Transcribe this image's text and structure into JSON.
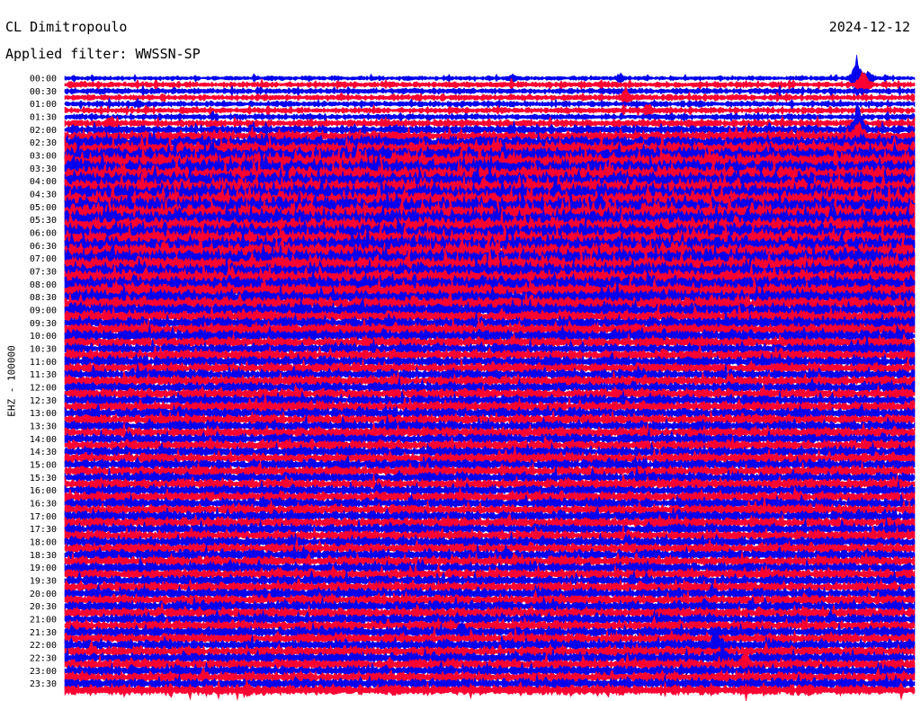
{
  "header": {
    "station": "CL Dimitropoulo",
    "date": "2024-12-12",
    "filter": "Applied filter: WWSSN-SP"
  },
  "chart_data": {
    "type": "line",
    "title": "CL Dimitropoulo",
    "subtitle": "Applied filter: WWSSN-SP",
    "date": "2024-12-12",
    "ylabel": "EHZ - 100000",
    "xlabel": "",
    "row_interval_minutes": 15,
    "row_labels": [
      "00:00",
      "00:30",
      "01:00",
      "01:30",
      "02:00",
      "02:30",
      "03:00",
      "03:30",
      "04:00",
      "04:30",
      "05:00",
      "05:30",
      "06:00",
      "06:30",
      "07:00",
      "07:30",
      "08:00",
      "08:30",
      "09:00",
      "09:30",
      "10:00",
      "10:30",
      "11:00",
      "11:30",
      "12:00",
      "12:30",
      "13:00",
      "13:30",
      "14:00",
      "14:30",
      "15:00",
      "15:30",
      "16:00",
      "16:30",
      "17:00",
      "17:30",
      "18:00",
      "18:30",
      "19:00",
      "19:30",
      "20:00",
      "20:30",
      "21:00",
      "21:30",
      "22:00",
      "22:30",
      "23:00",
      "23:30"
    ],
    "trace_colors": [
      "#0000ee",
      "#ff0033"
    ],
    "row_noise_level": [
      3,
      4,
      4,
      4,
      4,
      4,
      4,
      5,
      6,
      7,
      9,
      10,
      11,
      12,
      12,
      12,
      12,
      12,
      13,
      13,
      13,
      13,
      13,
      12,
      12,
      12,
      12,
      12,
      12,
      12,
      11,
      11,
      11,
      10,
      9,
      9,
      9,
      8,
      8,
      8,
      8,
      7,
      7,
      7,
      7,
      7,
      7,
      7,
      7,
      7,
      7,
      7,
      7,
      7,
      7,
      7,
      7,
      7,
      7,
      7,
      7,
      7,
      7,
      7,
      7,
      7,
      7,
      7,
      7,
      7,
      7,
      7,
      7,
      7,
      7,
      7,
      7,
      7,
      7,
      7,
      7,
      7,
      7,
      7,
      7,
      7,
      7,
      7,
      7,
      7,
      7,
      7,
      7,
      7,
      7,
      7
    ],
    "events": [
      {
        "row": 0,
        "minute": 14.2,
        "amplitude": 15
      },
      {
        "row": 0,
        "minute": 9.8,
        "amplitude": 10
      },
      {
        "row": 0,
        "minute": 7.9,
        "amplitude": 8
      },
      {
        "row": 0,
        "minute": 14.0,
        "amplitude": 40
      },
      {
        "row": 1,
        "minute": 14.1,
        "amplitude": 30
      },
      {
        "row": 3,
        "minute": 9.9,
        "amplitude": 18
      },
      {
        "row": 5,
        "minute": 10.3,
        "amplitude": 14
      },
      {
        "row": 7,
        "minute": 0.8,
        "amplitude": 14
      },
      {
        "row": 8,
        "minute": 14.0,
        "amplitude": 50
      },
      {
        "row": 9,
        "minute": 14.0,
        "amplitude": 40
      },
      {
        "row": 12,
        "minute": 2.6,
        "amplitude": 25
      },
      {
        "row": 13,
        "minute": 3.4,
        "amplitude": 22
      },
      {
        "row": 22,
        "minute": 2.0,
        "amplitude": 22
      },
      {
        "row": 74,
        "minute": 1.0,
        "amplitude": 10
      },
      {
        "row": 82,
        "minute": 11.3,
        "amplitude": 18
      },
      {
        "row": 86,
        "minute": 7.0,
        "amplitude": 20
      },
      {
        "row": 88,
        "minute": 11.5,
        "amplitude": 28
      },
      {
        "row": 90,
        "minute": 11.6,
        "amplitude": 30
      },
      {
        "row": 91,
        "minute": 12.0,
        "amplitude": 24
      }
    ]
  }
}
